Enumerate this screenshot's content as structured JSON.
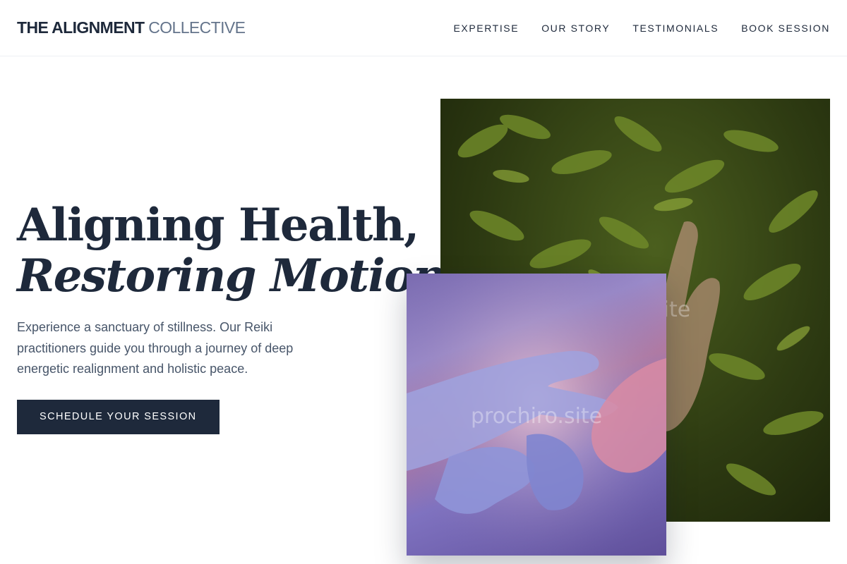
{
  "header": {
    "logo_bold": "THE ALIGNMENT",
    "logo_light": "COLLECTIVE",
    "nav": [
      {
        "label": "EXPERTISE"
      },
      {
        "label": "OUR STORY"
      },
      {
        "label": "TESTIMONIALS"
      },
      {
        "label": "BOOK SESSION"
      }
    ]
  },
  "hero": {
    "headline_line1": "Aligning Health,",
    "headline_line2": "Restoring Motion.",
    "lead": "Experience a sanctuary of stillness. Our Reiki practitioners guide you through a journey of deep energetic realignment and holistic peace.",
    "cta_label": "SCHEDULE YOUR SESSION"
  },
  "images": {
    "back_watermark": "site",
    "front_watermark": "prochiro.site"
  },
  "colors": {
    "primary": "#1e293b",
    "muted": "#64748b",
    "body_text": "#475569",
    "fern_green": "#4b5f1e",
    "hands_purple": "#7a6bb0"
  }
}
